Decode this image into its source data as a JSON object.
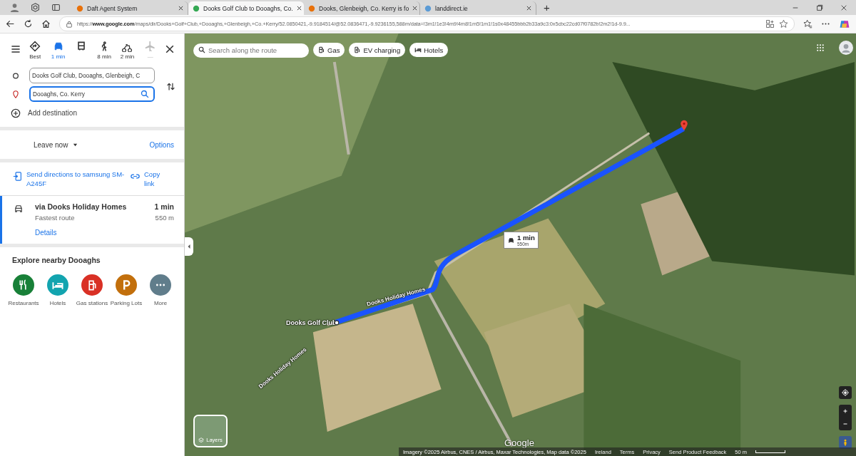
{
  "browser": {
    "tabs": [
      {
        "title": "Daft Agent System",
        "selected": false
      },
      {
        "title": "Dooks Golf Club to Dooaghs, Co.",
        "selected": true
      },
      {
        "title": "Dooks, Glenbeigh, Co. Kerry is fo",
        "selected": false
      },
      {
        "title": "landdirect.ie",
        "selected": false
      }
    ],
    "new_tab": "+",
    "address": {
      "prefix": "https://",
      "domain": "www.google.com",
      "path": "/maps/dir/Dooks+Golf+Club,+Dooaghs,+Glenbeigh,+Co.+Kerry/52.0850421,-9.9184514/@52.0836471,-9.9236155,588m/data=!3m1!1e3!4m9!4m8!1m5!1m1!1s0x48455bbb2b33a9c3:0x5cbc22cd07f0782b!2m2!1d-9.9..."
    }
  },
  "directions": {
    "modes": [
      {
        "kind": "best",
        "label": "Best",
        "selected": false,
        "disabled": false
      },
      {
        "kind": "car",
        "label": "1 min",
        "selected": true,
        "disabled": false
      },
      {
        "kind": "transit",
        "selected": false,
        "disabled": false
      },
      {
        "kind": "walk",
        "label": "8 min",
        "selected": false,
        "disabled": false
      },
      {
        "kind": "bike",
        "label": "2 min",
        "selected": false,
        "disabled": false
      },
      {
        "kind": "plane",
        "label": "—",
        "selected": false,
        "disabled": true
      }
    ],
    "origin": "Dooks Golf Club, Dooaghs, Glenbeigh, C",
    "destination": "Dooaghs, Co. Kerry",
    "add_destination": "Add destination",
    "leave_now": "Leave now",
    "options": "Options",
    "send": "Send directions to samsung SM-A245F",
    "copy_link": "Copy link",
    "route": {
      "title": "via Dooks Holiday Homes",
      "subtitle": "Fastest route",
      "time": "1 min",
      "distance": "550 m",
      "details": "Details",
      "selected": true
    }
  },
  "explore": {
    "title": "Explore nearby Dooaghs",
    "items": [
      {
        "kind": "restaurants",
        "label": "Restaurants",
        "color": "#188038"
      },
      {
        "kind": "hotels",
        "label": "Hotels",
        "color": "#12a4af"
      },
      {
        "kind": "gas",
        "label": "Gas stations",
        "color": "#d93025"
      },
      {
        "kind": "parking",
        "label": "Parking Lots",
        "color": "#c26f0c"
      },
      {
        "kind": "more",
        "label": "More",
        "color": "#607d8b"
      }
    ]
  },
  "map": {
    "search": {
      "placeholder": "Search along the route"
    },
    "chips": [
      {
        "kind": "gas",
        "label": "Gas"
      },
      {
        "kind": "ev",
        "label": "EV charging"
      },
      {
        "kind": "hotels",
        "label": "Hotels"
      }
    ],
    "route_badge": {
      "time": "1 min",
      "distance": "550m"
    },
    "start_label": "Dooks Golf Club",
    "road_labels": [
      "Dooks Holiday Homes",
      "Dooks Holiday Homes"
    ],
    "layers": "Layers",
    "logo": "Google",
    "footer": [
      "Imagery ©2025 Airbus, CNES / Airbus, Maxar Technologies, Map data ©2025",
      "Ireland",
      "Terms",
      "Privacy",
      "Send Product Feedback"
    ],
    "scale": "50 m"
  }
}
